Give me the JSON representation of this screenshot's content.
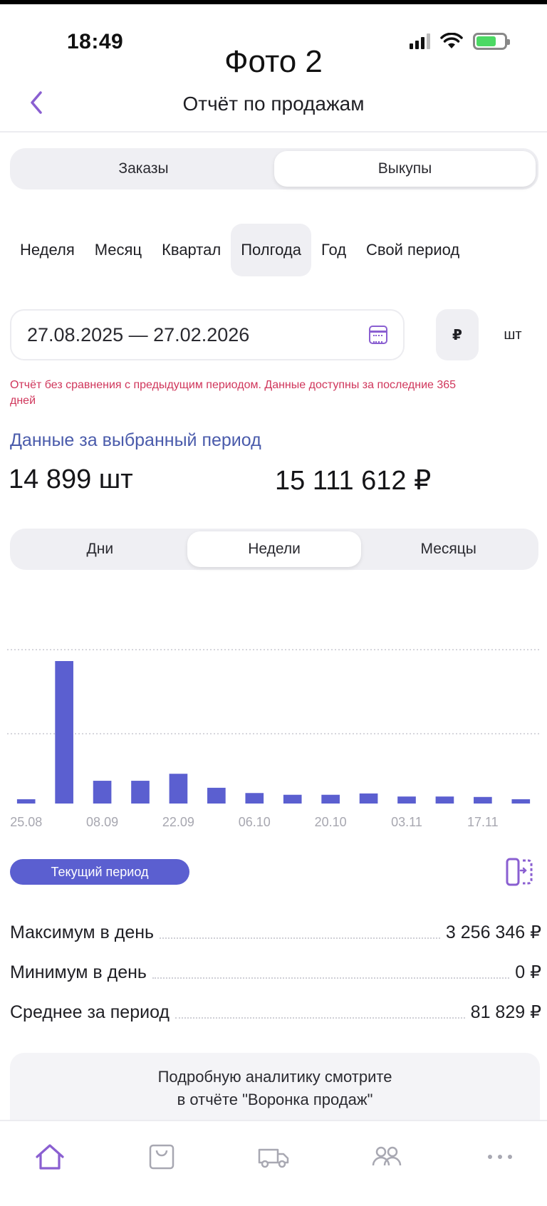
{
  "status_bar": {
    "time": "18:49",
    "battery_level": 0.7
  },
  "caption": "Фото 2",
  "header": {
    "title": "Отчёт по продажам",
    "back_icon": "chevron-left-icon"
  },
  "report_type": {
    "options": [
      "Заказы",
      "Выкупы"
    ],
    "selected": "Выкупы"
  },
  "periods": {
    "options": [
      "Неделя",
      "Месяц",
      "Квартал",
      "Полгода",
      "Год",
      "Свой период"
    ],
    "selected": "Полгода"
  },
  "date_range": {
    "value": "27.08.2025 — 27.02.2026",
    "icon": "calendar-icon"
  },
  "unit_toggle": {
    "currency": "₽",
    "units": "шт",
    "selected": "₽"
  },
  "warning": "Отчёт без сравнения с предыдущим периодом. Данные доступны за последние 365 дней",
  "summary": {
    "title": "Данные за выбранный период",
    "units_total": "14 899 шт",
    "rub_total": "15 111 612 ₽"
  },
  "granularity": {
    "options": [
      "Дни",
      "Недели",
      "Месяцы"
    ],
    "selected": "Недели"
  },
  "chart_data": {
    "type": "bar",
    "categories": [
      "25.08",
      "01.09",
      "08.09",
      "15.09",
      "22.09",
      "29.09",
      "06.10",
      "13.10",
      "20.10",
      "27.10",
      "03.11",
      "10.11",
      "17.11",
      "24.11"
    ],
    "tick_labels": [
      "25.08",
      "08.09",
      "22.09",
      "06.10",
      "20.10",
      "03.11",
      "17.11"
    ],
    "values": [
      80000,
      3256346,
      520000,
      520000,
      680000,
      360000,
      240000,
      200000,
      200000,
      230000,
      160000,
      160000,
      150000,
      80000
    ],
    "ylim": [
      0,
      3600000
    ],
    "gridlines": [
      1800000,
      3600000
    ],
    "grid": true,
    "color": "#5b5fd0"
  },
  "current_period_label": "Текущий период",
  "compare_icon": "compare-toggle-icon",
  "stats": [
    {
      "label": "Максимум в день",
      "value": "3 256 346 ₽"
    },
    {
      "label": "Минимум в день",
      "value": "0 ₽"
    },
    {
      "label": "Среднее за период",
      "value": "81 829 ₽"
    }
  ],
  "info_card": {
    "line1": "Подробную аналитику смотрите",
    "line2": "в отчёте \"Воронка продаж\""
  },
  "tabbar": {
    "items": [
      "home-icon",
      "bag-icon",
      "truck-icon",
      "people-icon",
      "more-icon"
    ],
    "active_color": "#8a5fd1",
    "inactive_color": "#a8a8b2"
  }
}
